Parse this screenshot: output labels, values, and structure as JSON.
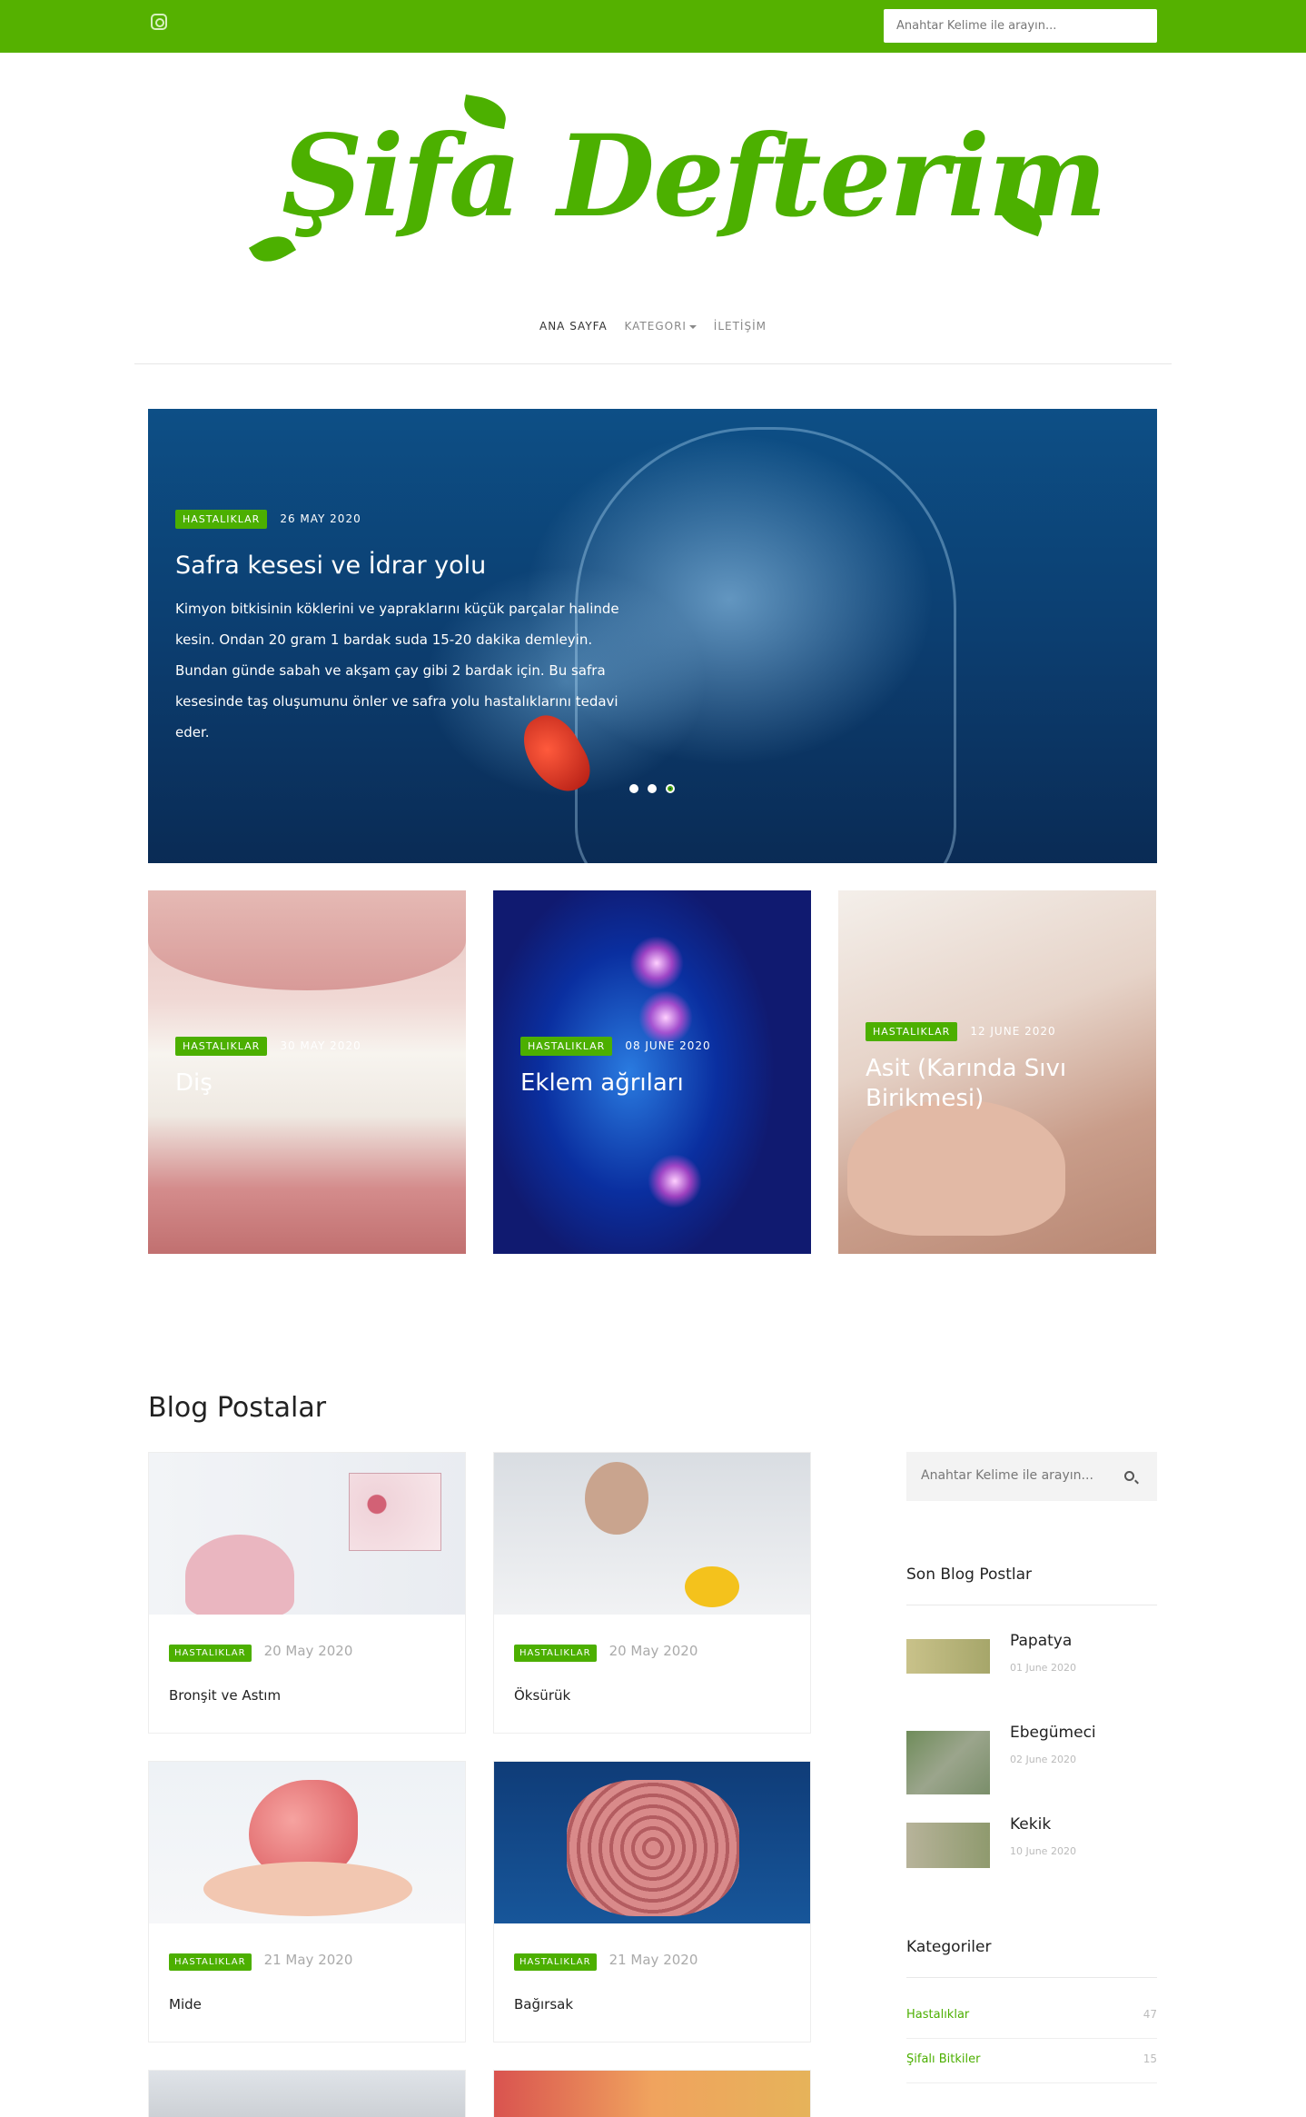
{
  "header": {
    "search_placeholder": "Anahtar Kelime ile arayın...",
    "logo_text": "Şifa Defterim"
  },
  "nav": {
    "items": [
      {
        "label": "ANA SAYFA"
      },
      {
        "label": "KATEGORI"
      },
      {
        "label": "İLETİŞİM"
      }
    ]
  },
  "hero": {
    "category": "HASTALIKLAR",
    "date": "26 MAY 2020",
    "title": "Safra kesesi ve İdrar yolu",
    "text": "Kimyon bitkisinin köklerini ve yapraklarını küçük parçalar halinde kesin. Ondan 20 gram 1 bardak suda 15-20 dakika demleyin. Bundan günde sabah ve akşam çay gibi 2 bardak için. Bu safra kesesinde taş oluşumunu önler ve safra yolu hastalıklarını tedavi eder."
  },
  "featured": [
    {
      "category": "HASTALIKLAR",
      "date": "30 MAY 2020",
      "title": "Diş"
    },
    {
      "category": "HASTALIKLAR",
      "date": "08 JUNE 2020",
      "title": "Eklem ağrıları"
    },
    {
      "category": "HASTALIKLAR",
      "date": "12 JUNE 2020",
      "title": "Asit (Karında Sıvı Birikmesi)"
    }
  ],
  "blog": {
    "section_title": "Blog Postalar",
    "posts": [
      {
        "category": "HASTALIKLAR",
        "date": "20 May 2020",
        "title": "Bronşit ve Astım"
      },
      {
        "category": "HASTALIKLAR",
        "date": "20 May 2020",
        "title": "Öksürük"
      },
      {
        "category": "HASTALIKLAR",
        "date": "21 May 2020",
        "title": "Mide"
      },
      {
        "category": "HASTALIKLAR",
        "date": "21 May 2020",
        "title": "Bağırsak"
      }
    ]
  },
  "sidebar": {
    "search_placeholder": "Anahtar Kelime ile arayın...",
    "recent_heading": "Son Blog Postlar",
    "recent": [
      {
        "title": "Papatya",
        "date": "01 June 2020"
      },
      {
        "title": "Ebegümeci",
        "date": "02 June 2020"
      },
      {
        "title": "Kekik",
        "date": "10 June 2020"
      }
    ],
    "categories_heading": "Kategoriler",
    "categories": [
      {
        "name": "Hastalıklar",
        "count": "47"
      },
      {
        "name": "Şifalı Bitkiler",
        "count": "15"
      }
    ]
  },
  "colors": {
    "brand": "#55b100",
    "badge": "#4caf00"
  }
}
